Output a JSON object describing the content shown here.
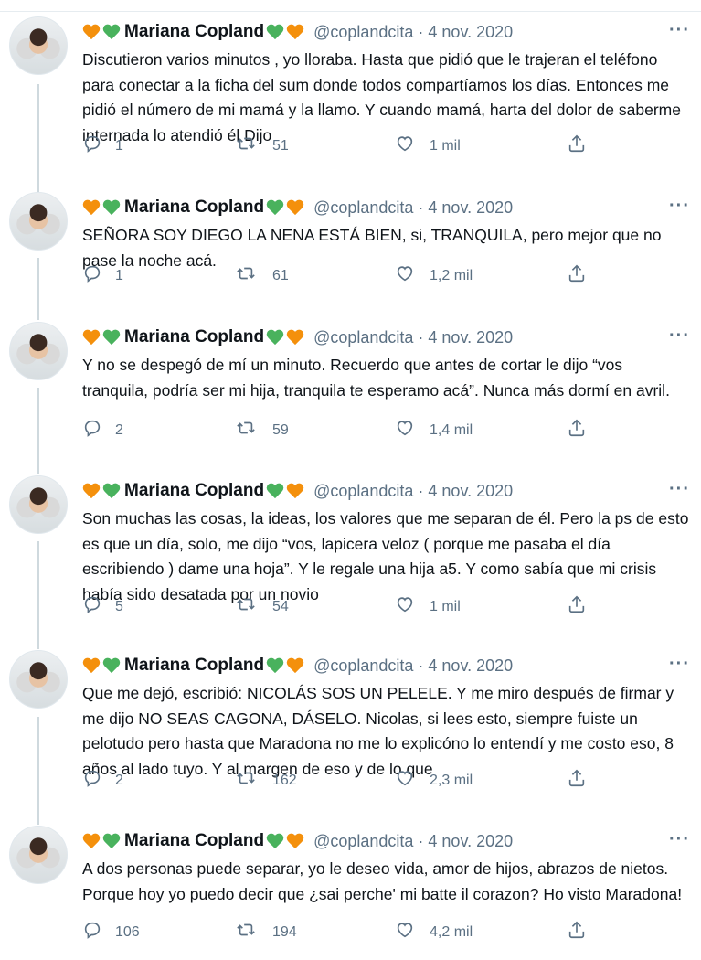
{
  "tweets": [
    {
      "author": "Mariana Copland",
      "handle": "@coplandcita · 4 nov. 2020",
      "text": "Discutieron varios minutos , yo lloraba. Hasta que pidió que le trajeran el teléfono para conectar a la ficha del sum donde todos compartíamos los días. Entonces me pidió el número de mi mamá y la llamo. Y cuando mamá, harta del dolor de saberme internada lo atendió él Dijo",
      "replies": "1",
      "retweets": "51",
      "likes": "1 mil"
    },
    {
      "author": "Mariana Copland",
      "handle": "@coplandcita · 4 nov. 2020",
      "text": "SEÑORA SOY DIEGO LA NENA ESTÁ BIEN, si, TRANQUILA, pero mejor que no pase la noche acá.",
      "replies": "1",
      "retweets": "61",
      "likes": "1,2 mil"
    },
    {
      "author": "Mariana Copland",
      "handle": "@coplandcita · 4 nov. 2020",
      "text": "Y no se despegó de mí un minuto. Recuerdo que antes de cortar le dijo “vos tranquila, podría ser mi hija, tranquila te esperamo acá”. Nunca más dormí en avril.",
      "replies": "2",
      "retweets": "59",
      "likes": "1,4 mil"
    },
    {
      "author": "Mariana Copland",
      "handle": "@coplandcita · 4 nov. 2020",
      "text": "Son muchas las cosas, la ideas, los valores que me separan de él. Pero la ps de esto es que un día, solo, me dijo “vos, lapicera veloz ( porque me pasaba el día escribiendo ) dame una hoja”. Y le regale una hija a5. Y como sabía que mi crisis había sido desatada por un novio",
      "replies": "5",
      "retweets": "54",
      "likes": "1 mil"
    },
    {
      "author": "Mariana Copland",
      "handle": "@coplandcita · 4 nov. 2020",
      "text": "Que me dejó, escribió: NICOLÁS SOS UN PELELE. Y me miro después de firmar y me dijo NO SEAS CAGONA, DÁSELO. Nicolas, si lees esto, siempre fuiste un pelotudo pero hasta que Maradona no me lo explicóno lo entendí y me costo eso, 8 años al lado tuyo. Y al margen de eso y de lo que",
      "replies": "2",
      "retweets": "162",
      "likes": "2,3 mil"
    },
    {
      "author": "Mariana Copland",
      "handle": "@coplandcita · 4 nov. 2020",
      "text": "A dos personas puede separar, yo le deseo vida, amor de hijos, abrazos de nietos. Porque hoy yo puedo decir que ¿sai perche' mi batte il corazon? Ho visto Maradona!",
      "replies": "106",
      "retweets": "194",
      "likes": "4,2 mil"
    }
  ],
  "icons": {
    "heart_left": [
      "orange-heart",
      "green-heart"
    ],
    "heart_right": [
      "green-heart",
      "orange-heart"
    ],
    "menu": "more-dots-icon",
    "reply": "reply-icon",
    "retweet": "retweet-icon",
    "like": "like-icon",
    "share": "share-icon"
  },
  "colors": {
    "text": "#0f1419",
    "muted": "#5b7083",
    "orange_heart": "#f4900c",
    "green_heart": "#49b25d"
  }
}
